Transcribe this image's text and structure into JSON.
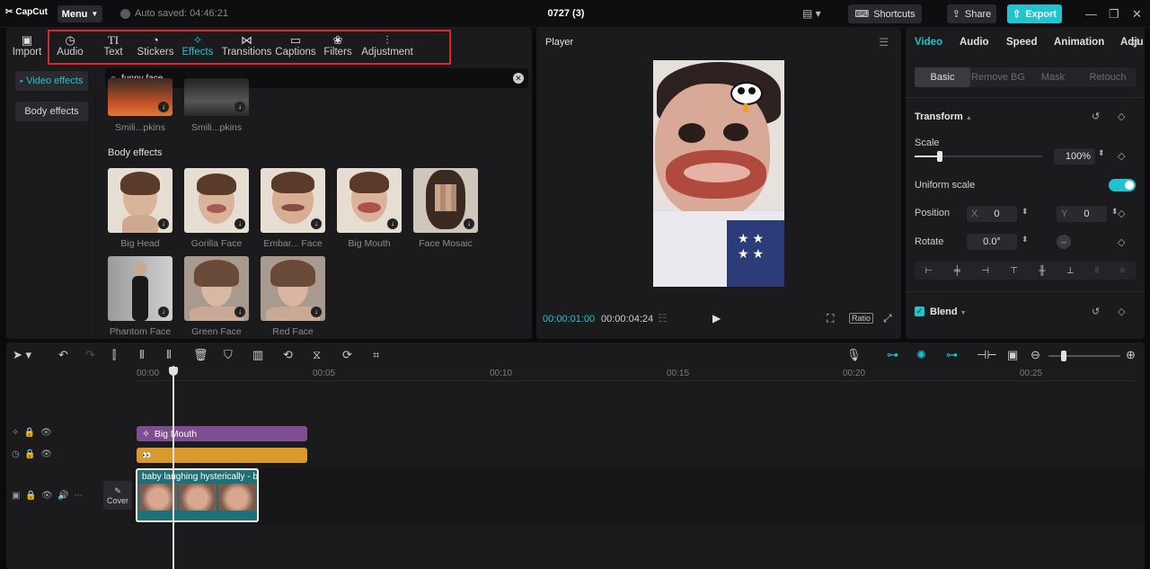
{
  "app": {
    "logo": "CapCut",
    "menu_label": "Menu",
    "autosave": "Auto saved: 04:46:21",
    "project_title": "0727 (3)"
  },
  "topbar": {
    "shortcuts": "Shortcuts",
    "share": "Share",
    "export": "Export"
  },
  "media_tabs": [
    {
      "label": "Import",
      "icon": "import-icon"
    },
    {
      "label": "Audio",
      "icon": "audio-icon"
    },
    {
      "label": "Text",
      "icon": "text-icon"
    },
    {
      "label": "Stickers",
      "icon": "stickers-icon"
    },
    {
      "label": "Effects",
      "icon": "effects-icon",
      "active": true
    },
    {
      "label": "Transitions",
      "icon": "transitions-icon"
    },
    {
      "label": "Captions",
      "icon": "captions-icon"
    },
    {
      "label": "Filters",
      "icon": "filters-icon"
    },
    {
      "label": "Adjustment",
      "icon": "adjustment-icon"
    }
  ],
  "sidebar": {
    "items": [
      {
        "label": "Video effects",
        "active": true
      },
      {
        "label": "Body effects"
      }
    ]
  },
  "search": {
    "value": "funny face"
  },
  "top_results": [
    {
      "label": "Smili...pkins"
    },
    {
      "label": "Smili...pkins"
    }
  ],
  "body_effects": {
    "heading": "Body effects",
    "items": [
      {
        "label": "Big Head"
      },
      {
        "label": "Gorilla Face"
      },
      {
        "label": "Embar... Face"
      },
      {
        "label": "Big Mouth"
      },
      {
        "label": "Face Mosaic"
      },
      {
        "label": "Phantom Face"
      },
      {
        "label": "Green Face"
      },
      {
        "label": "Red Face"
      }
    ]
  },
  "player": {
    "title": "Player",
    "current_time": "00:00:01:00",
    "total_time": "00:00:04:24",
    "ratio_label": "Ratio"
  },
  "inspector": {
    "tabs": [
      "Video",
      "Audio",
      "Speed",
      "Animation",
      "Adju"
    ],
    "subtabs": [
      "Basic",
      "Remove BG",
      "Mask",
      "Retouch"
    ],
    "transform_label": "Transform",
    "scale_label": "Scale",
    "scale_value": "100%",
    "scale_fraction": 0.1,
    "uniform_scale_label": "Uniform scale",
    "position_label": "Position",
    "pos_x_label": "X",
    "pos_x_value": "0",
    "pos_y_label": "Y",
    "pos_y_value": "0",
    "rotate_label": "Rotate",
    "rotate_value": "0.0°",
    "blend_label": "Blend"
  },
  "timeline": {
    "ruler": [
      "00:00",
      "00:05",
      "00:10",
      "00:15",
      "00:20",
      "00:25"
    ],
    "effect_clip": "Big Mouth",
    "video_clip": "baby laughing hysterically - b",
    "cover_label": "Cover"
  },
  "colors": {
    "accent": "#20c4cf",
    "highlight_box": "#e0262a",
    "effect_clip": "#7d4f91",
    "filter_clip": "#d89a2c",
    "video_clip": "#1f6f76"
  }
}
